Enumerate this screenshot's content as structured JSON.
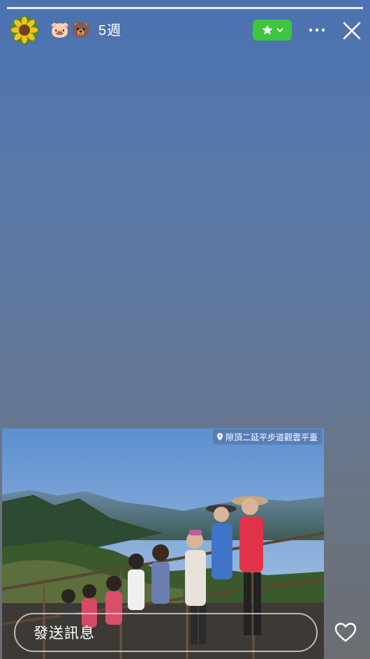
{
  "story": {
    "progress_segments": 1,
    "elapsed_label": "5週",
    "user_emojis": [
      "🐷",
      "🐻"
    ],
    "location": "隙頂二延平步道觀雲平臺",
    "message_placeholder": "發送訊息"
  },
  "icons": {
    "avatar": "sunflower-avatar",
    "favorite": "star-icon",
    "favorite_arrow": "chevron-down-icon",
    "more": "more-dots-icon",
    "close": "close-icon",
    "location": "location-pin-icon",
    "like": "heart-icon"
  },
  "colors": {
    "favorite_button": "#3fc53f",
    "top_gradient": "#4b72b2",
    "bottom_gradient": "#6b6d72"
  }
}
